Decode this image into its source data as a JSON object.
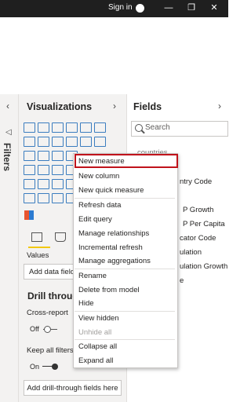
{
  "titlebar": {
    "sign_in": "Sign in",
    "minimize_glyph": "—",
    "restore_glyph": "❐",
    "close_glyph": "✕"
  },
  "left_pane": {
    "collapse_glyph": "‹",
    "filters_arrow_glyph": "◁",
    "filters_label": "Filters"
  },
  "visualizations": {
    "title": "Visualizations",
    "expand_glyph": "›",
    "values_label": "Values",
    "add_data_fields": "Add data fields",
    "drillthrough_title": "Drill throug",
    "cross_report_label": "Cross-report",
    "cross_report_state": "Off",
    "keep_all_filters_label": "Keep all filters",
    "keep_all_filters_state": "On",
    "add_drillthrough_button": "Add drill-through fields here",
    "accent_color": "#f2c811"
  },
  "fields": {
    "title": "Fields",
    "expand_glyph": "›",
    "search_placeholder": "Search",
    "table_name": "countries",
    "items": [
      "ntry Code",
      "P Growth",
      "P Per Capita",
      "cator Code",
      "ulation",
      "ulation Growth",
      "e"
    ]
  },
  "context_menu": {
    "items": [
      {
        "label": "New measure",
        "enabled": true,
        "highlighted": true
      },
      {
        "label": "New column",
        "enabled": true
      },
      {
        "label": "New quick measure",
        "enabled": true
      },
      {
        "label": "Refresh data",
        "enabled": true
      },
      {
        "label": "Edit query",
        "enabled": true
      },
      {
        "label": "Manage relationships",
        "enabled": true
      },
      {
        "label": "Incremental refresh",
        "enabled": true
      },
      {
        "label": "Manage aggregations",
        "enabled": true
      },
      {
        "label": "Rename",
        "enabled": true
      },
      {
        "label": "Delete from model",
        "enabled": true
      },
      {
        "label": "Hide",
        "enabled": true
      },
      {
        "label": "View hidden",
        "enabled": true
      },
      {
        "label": "Unhide all",
        "enabled": false
      },
      {
        "label": "Collapse all",
        "enabled": true
      },
      {
        "label": "Expand all",
        "enabled": true
      }
    ],
    "highlight_color": "#c0131b"
  }
}
